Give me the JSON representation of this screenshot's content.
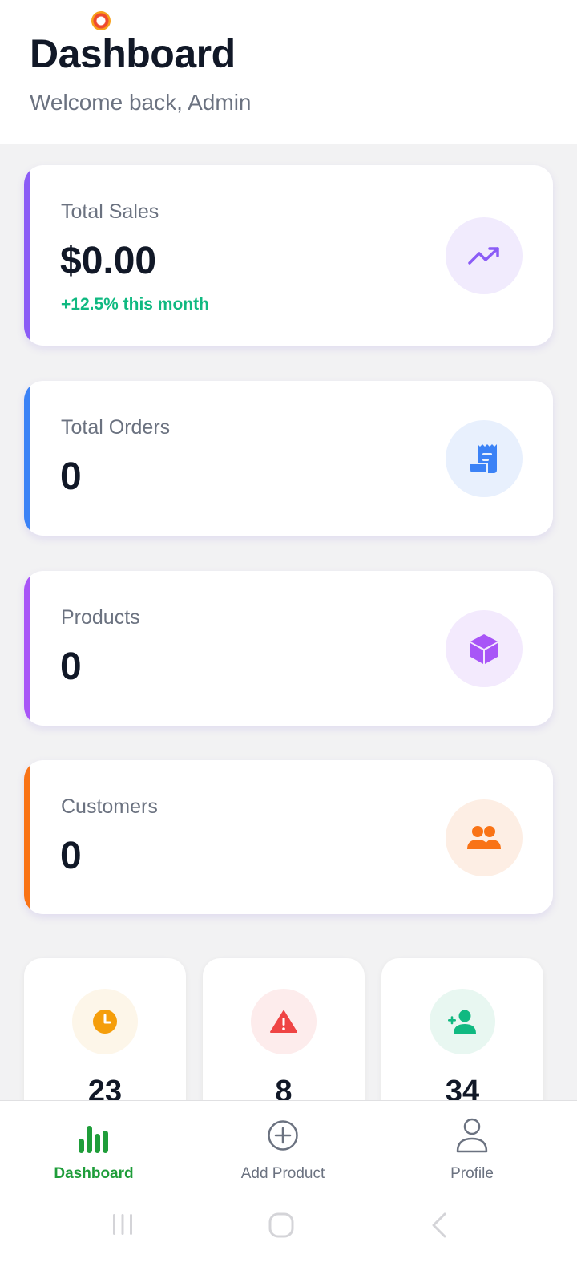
{
  "header": {
    "title": "Dashboard",
    "subtitle": "Welcome back, Admin"
  },
  "stats": [
    {
      "label": "Total Sales",
      "value": "$0.00",
      "change": "+12.5% this month",
      "icon": "trending-up-icon",
      "accent": "#8b5cf6",
      "icon_color": "#8b5cf6",
      "icon_bg": "#f1ebfd"
    },
    {
      "label": "Total Orders",
      "value": "0",
      "icon": "receipt-icon",
      "accent": "#3b82f6",
      "icon_color": "#3b82f6",
      "icon_bg": "#e8f0fd"
    },
    {
      "label": "Products",
      "value": "0",
      "icon": "cube-icon",
      "accent": "#a855f7",
      "icon_color": "#a855f7",
      "icon_bg": "#f3eafd"
    },
    {
      "label": "Customers",
      "value": "0",
      "icon": "people-icon",
      "accent": "#f97316",
      "icon_color": "#f97316",
      "icon_bg": "#fdeee4"
    }
  ],
  "mini_stats": [
    {
      "value": "23",
      "icon": "clock-icon",
      "icon_color": "#f59e0b",
      "icon_bg": "#fdf6e9"
    },
    {
      "value": "8",
      "icon": "warning-icon",
      "icon_color": "#ef4444",
      "icon_bg": "#fdecec"
    },
    {
      "value": "34",
      "icon": "add-person-icon",
      "icon_color": "#10b981",
      "icon_bg": "#e8f7f1"
    }
  ],
  "nav": {
    "items": [
      {
        "label": "Dashboard",
        "icon": "bar-chart-icon",
        "active": true
      },
      {
        "label": "Add Product",
        "icon": "plus-circle-icon",
        "active": false
      },
      {
        "label": "Profile",
        "icon": "person-icon",
        "active": false
      }
    ],
    "active_color": "#1f9d3a"
  },
  "system_bar": {
    "buttons": [
      "recents-icon",
      "home-icon",
      "back-icon"
    ]
  }
}
